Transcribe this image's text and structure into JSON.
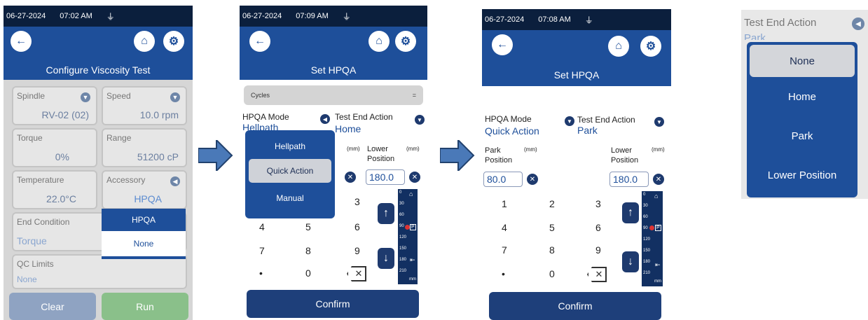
{
  "p1": {
    "date": "06-27-2024",
    "time": "07:02 AM",
    "title": "Configure Viscosity Test",
    "spindle": {
      "label": "Spindle",
      "value": "RV-02 (02)"
    },
    "speed": {
      "label": "Speed",
      "value": "10.0 rpm"
    },
    "torque": {
      "label": "Torque",
      "value": "0%"
    },
    "range": {
      "label": "Range",
      "value": "51200 cP"
    },
    "temperature": {
      "label": "Temperature",
      "value": "22.0°C"
    },
    "accessory": {
      "label": "Accessory",
      "value": "HPQA"
    },
    "end_condition": {
      "label": "End Condition",
      "value": "Torque"
    },
    "qc_limits": {
      "label": "QC Limits",
      "value": "None"
    },
    "dropdown": [
      "HPQA",
      "None"
    ],
    "clear": "Clear",
    "run": "Run"
  },
  "p2": {
    "date": "06-27-2024",
    "time": "07:09 AM",
    "title": "Set HPQA",
    "cycles": "Cycles",
    "cycles_value": "=",
    "mode_label": "HPQA Mode",
    "mode_value": "Hellpath",
    "end_label": "Test End Action",
    "end_value": "Home",
    "unit": "(mm)",
    "lower_label": "Lower",
    "lower_label2": "Position",
    "lower_value": "180.0",
    "menu": [
      "Hellpath",
      "Quick Action",
      "Manual"
    ],
    "keys": [
      "3",
      "4",
      "5",
      "6",
      "7",
      "8",
      "9",
      "•",
      "0"
    ],
    "confirm": "Confirm"
  },
  "p3": {
    "date": "06-27-2024",
    "time": "07:08 AM",
    "title": "Set HPQA",
    "mode_label": "HPQA Mode",
    "mode_value": "Quick Action",
    "end_label": "Test End Action",
    "end_value": "Park",
    "park_label": "Park",
    "park_label2": "Position",
    "unit": "(mm)",
    "park_value": "80.0",
    "lower_label": "Lower",
    "lower_label2": "Position",
    "lower_value": "180.0",
    "keys": [
      "1",
      "2",
      "3",
      "4",
      "5",
      "6",
      "7",
      "8",
      "9",
      "•",
      "0"
    ],
    "confirm": "Confirm"
  },
  "p4": {
    "label": "Test End Action",
    "partial": "Park",
    "options": [
      "None",
      "Home",
      "Park",
      "Lower Position"
    ]
  },
  "ruler": [
    "0",
    "30",
    "60",
    "90",
    "120",
    "150",
    "180",
    "210",
    "mm"
  ],
  "ruler_p": "P"
}
